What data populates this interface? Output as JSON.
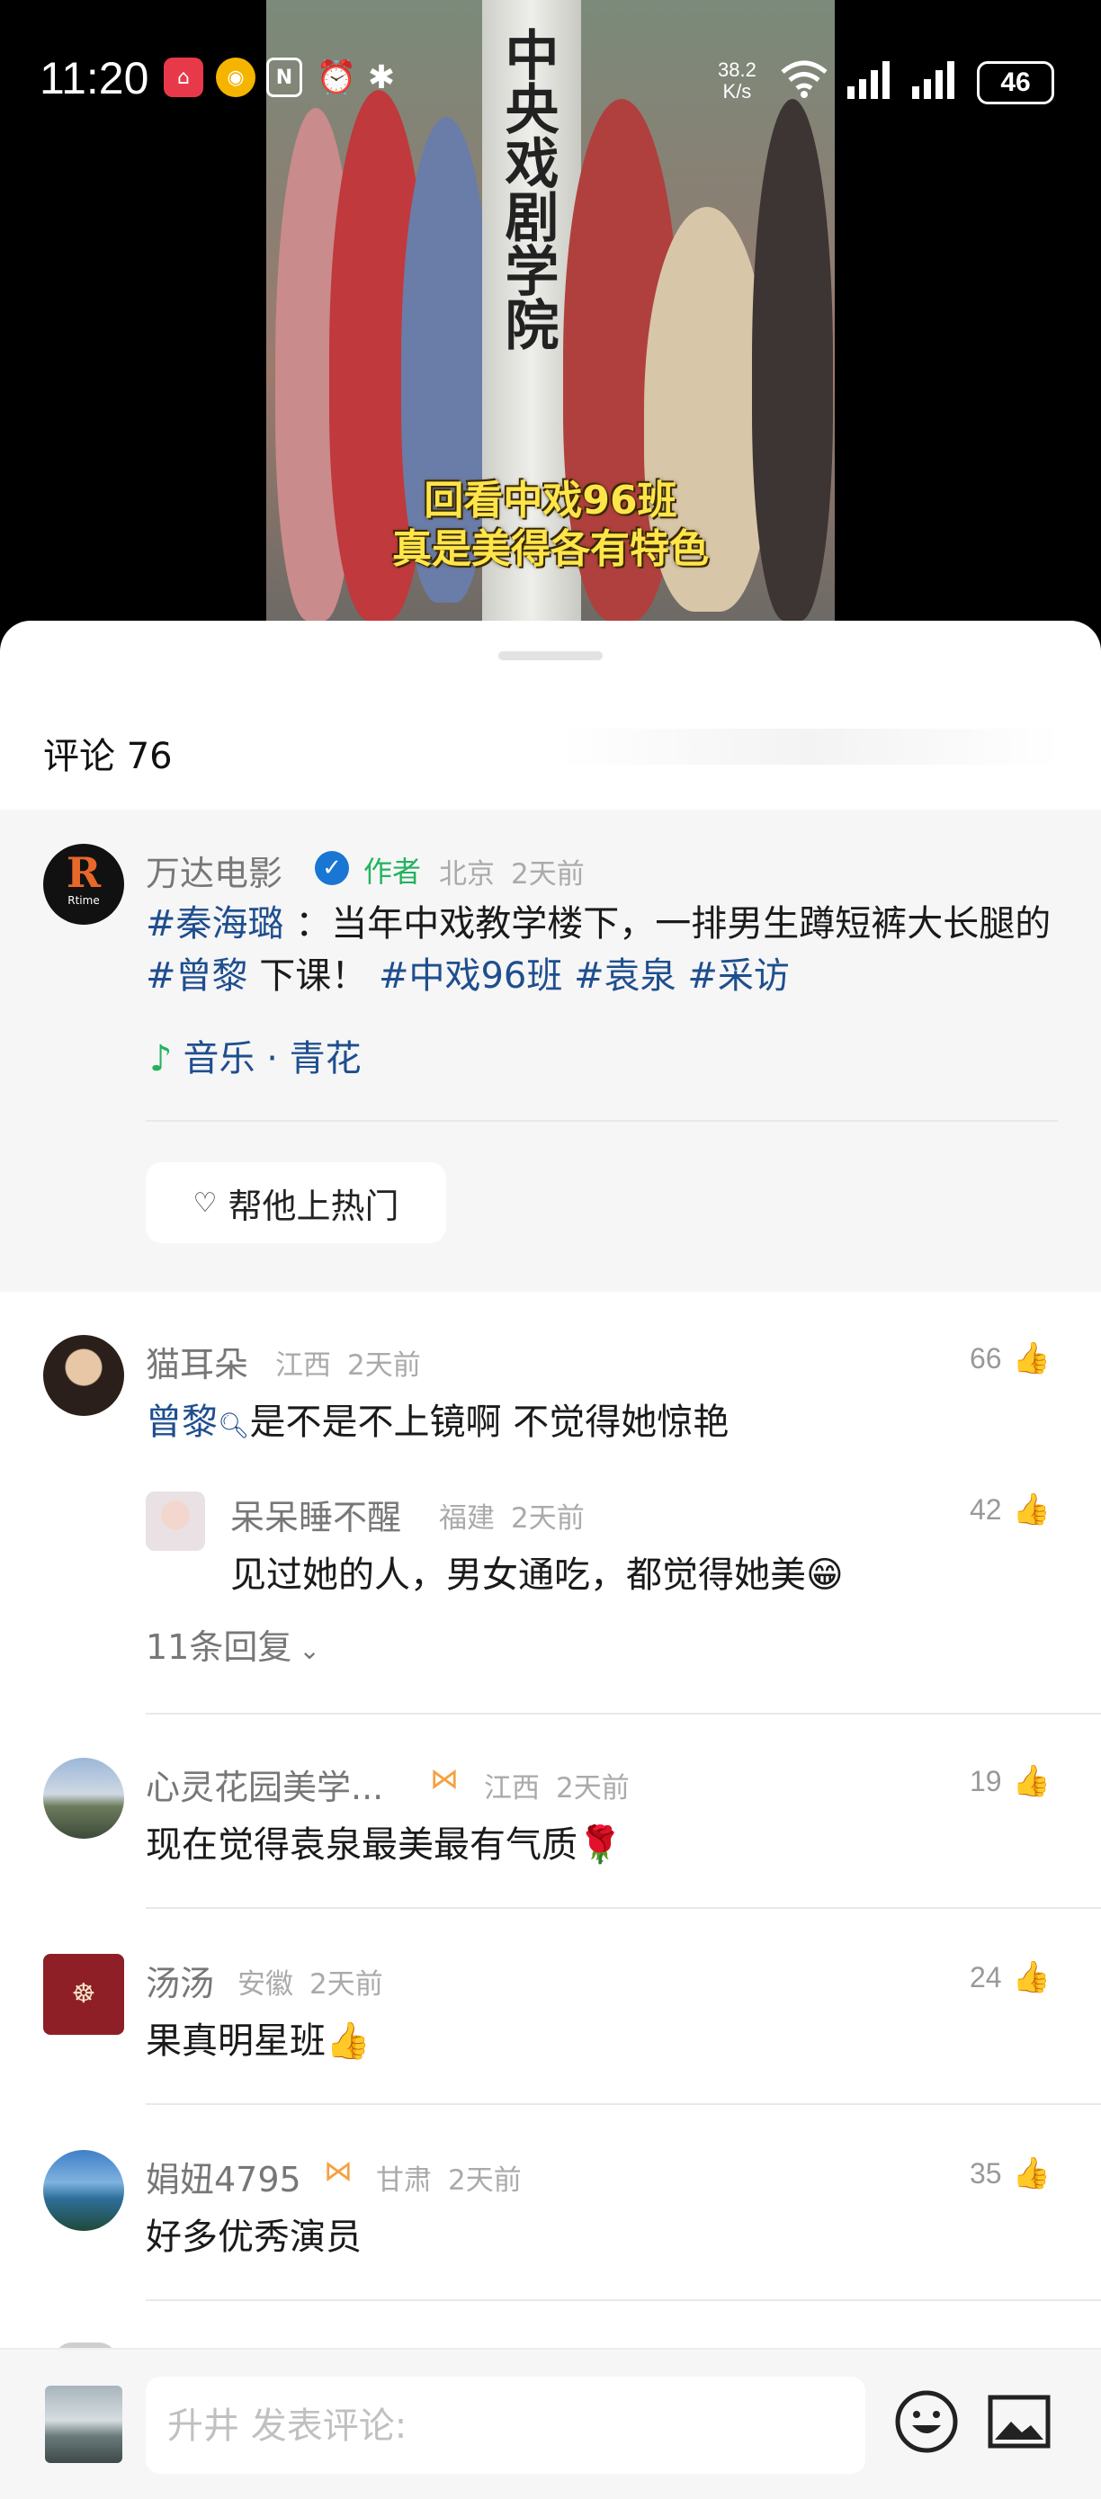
{
  "status_bar": {
    "time": "11:20",
    "net_speed": "38.2",
    "net_unit": "K/s",
    "battery": "46"
  },
  "video": {
    "gate_text": "中央戏剧学院",
    "caption_line1": "回看中戏96班",
    "caption_line2": "真是美得各有特色"
  },
  "header": {
    "title": "评论 76"
  },
  "author_post": {
    "name": "万达电影",
    "tag": "作者",
    "location": "北京",
    "time": "2天前",
    "text_parts": [
      {
        "t": "#秦海璐",
        "hashtag": true
      },
      {
        "t": " ：当年中戏教学楼下，一排男生蹲短裤大长腿的",
        "hashtag": false
      },
      {
        "t": "#曾黎",
        "hashtag": true
      },
      {
        "t": " 下课！ ",
        "hashtag": false
      },
      {
        "t": "#中戏96班",
        "hashtag": true
      },
      {
        "t": " ",
        "hashtag": false
      },
      {
        "t": "#袁泉",
        "hashtag": true
      },
      {
        "t": " ",
        "hashtag": false
      },
      {
        "t": "#采访",
        "hashtag": true
      }
    ],
    "music": "音乐 · 青花",
    "boost_button": "帮他上热门"
  },
  "comments": [
    {
      "name": "猫耳朵",
      "location": "江西",
      "time": "2天前",
      "likes": "66",
      "text_link": "曾黎",
      "text": "是不是不上镜啊 不觉得她惊艳",
      "reply": {
        "name": "呆呆睡不醒",
        "location": "福建",
        "time": "2天前",
        "likes": "42",
        "text": "见过她的人，男女通吃，都觉得她美😁"
      },
      "more_replies": "11条回复"
    },
    {
      "name": "心灵花园美学...",
      "location": "江西",
      "time": "2天前",
      "likes": "19",
      "text": "现在觉得袁泉最美最有气质🌹"
    },
    {
      "name": "汤汤",
      "location": "安徽",
      "time": "2天前",
      "likes": "24",
      "text": "果真明星班👍"
    },
    {
      "name": "娟妞4795",
      "location": "甘肃",
      "time": "2天前",
      "likes": "35",
      "text": "好多优秀演员"
    }
  ],
  "bottom_bar": {
    "placeholder": "升井 发表评论:"
  }
}
